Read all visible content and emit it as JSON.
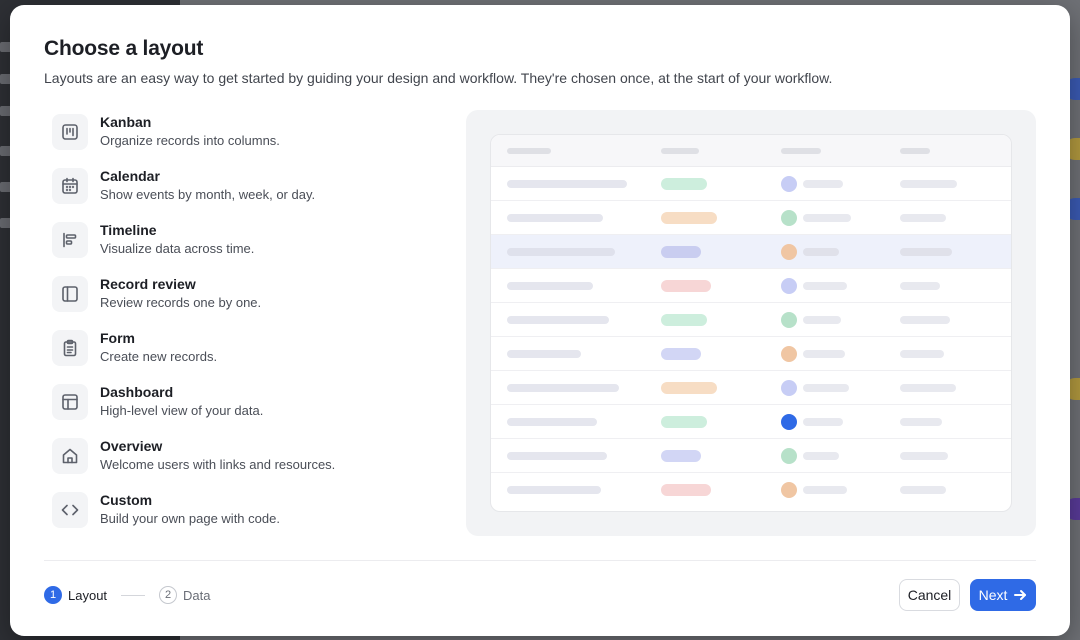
{
  "modal": {
    "title": "Choose a layout",
    "subtitle": "Layouts are an easy way to get started by guiding your design and workflow. They're chosen once, at the start of your workflow."
  },
  "layouts": [
    {
      "name": "Kanban",
      "description": "Organize records into columns.",
      "icon": "kanban-icon"
    },
    {
      "name": "Calendar",
      "description": "Show events by month, week, or day.",
      "icon": "calendar-icon"
    },
    {
      "name": "Timeline",
      "description": "Visualize data across time.",
      "icon": "timeline-icon"
    },
    {
      "name": "Record review",
      "description": "Review records one by one.",
      "icon": "record-review-icon"
    },
    {
      "name": "Form",
      "description": "Create new records.",
      "icon": "form-icon"
    },
    {
      "name": "Dashboard",
      "description": "High-level view of your data.",
      "icon": "dashboard-icon"
    },
    {
      "name": "Overview",
      "description": "Welcome users with links and resources.",
      "icon": "home-icon"
    },
    {
      "name": "Custom",
      "description": "Build your own page with code.",
      "icon": "code-icon"
    }
  ],
  "steps": [
    {
      "number": "1",
      "label": "Layout",
      "active": true
    },
    {
      "number": "2",
      "label": "Data",
      "active": false
    }
  ],
  "buttons": {
    "cancel": "Cancel",
    "next": "Next"
  },
  "colors": {
    "accent": "#2f6ae6",
    "tag_green": "#cdeedd",
    "tag_orange": "#f7ddc4",
    "tag_blue": "#d2d6f5",
    "tag_red": "#f7d6d6"
  }
}
